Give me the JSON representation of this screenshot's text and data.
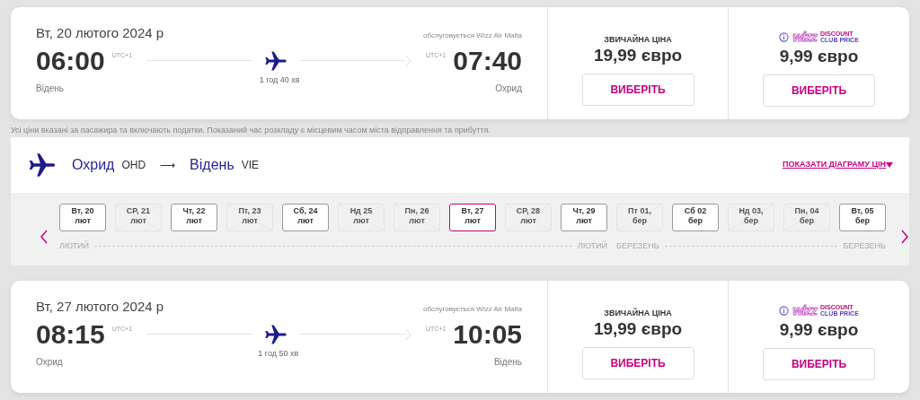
{
  "flights": [
    {
      "date": "Вт, 20 лютого 2024 р",
      "operator": "обслуговується Wizz Air Malta",
      "depart_time": "06:00",
      "depart_tz": "UTC+1",
      "depart_city": "Відень",
      "duration": "1 год 40 хв",
      "arrive_tz": "UTC+1",
      "arrive_time": "07:40",
      "arrive_city": "Охрид",
      "fares": [
        {
          "kind": "regular",
          "label": "ЗВИЧАЙНА ЦІНА",
          "price": "19,99 євро",
          "button": "ВИБЕРІТЬ"
        },
        {
          "kind": "club",
          "logo": "wizz",
          "logo_line1": "DISCOUNT",
          "logo_line2": "CLUB PRICE",
          "price": "9,99 євро",
          "button": "ВИБЕРІТЬ"
        }
      ]
    },
    {
      "date": "Вт, 27 лютого 2024 р",
      "operator": "обслуговується Wizz Air Malta",
      "depart_time": "08:15",
      "depart_tz": "UTC+1",
      "depart_city": "Охрид",
      "duration": "1 год 50 хв",
      "arrive_tz": "UTC+1",
      "arrive_time": "10:05",
      "arrive_city": "Відень",
      "fares": [
        {
          "kind": "regular",
          "label": "ЗВИЧАЙНА ЦІНА",
          "price": "19,99 євро",
          "button": "ВИБЕРІТЬ"
        },
        {
          "kind": "club",
          "logo": "wizz",
          "logo_line1": "DISCOUNT",
          "logo_line2": "CLUB PRICE",
          "price": "9,99 євро",
          "button": "ВИБЕРІТЬ"
        }
      ]
    }
  ],
  "note": "Усі ціни вказані за пасажира та включають податки. Показаний час розкладу є місцевим часом міста відправлення та прибуття.",
  "route": {
    "from_city": "Охрид",
    "from_code": "OHD",
    "arrow": "⟶",
    "to_city": "Відень",
    "to_code": "VIE",
    "chart_link": "ПОКАЗАТИ ДІАГРАМУ ЦІН"
  },
  "months": [
    {
      "labels": [
        "ЛЮТИЙ",
        "ЛЮТИЙ"
      ],
      "days": [
        {
          "day": "Вт, 20",
          "month": "лют",
          "available": true,
          "selected": false
        },
        {
          "day": "СР, 21",
          "month": "лют",
          "available": false,
          "selected": false
        },
        {
          "day": "Чт, 22",
          "month": "лют",
          "available": true,
          "selected": false
        },
        {
          "day": "Пт, 23",
          "month": "лют",
          "available": false,
          "selected": false
        },
        {
          "day": "Сб, 24",
          "month": "лют",
          "available": true,
          "selected": false
        },
        {
          "day": "Нд 25",
          "month": "лют",
          "available": false,
          "selected": false
        },
        {
          "day": "Пн, 26",
          "month": "лют",
          "available": false,
          "selected": false
        },
        {
          "day": "Вт, 27",
          "month": "лют",
          "available": true,
          "selected": true
        },
        {
          "day": "СР, 28",
          "month": "лют",
          "available": false,
          "selected": false
        },
        {
          "day": "Чт, 29",
          "month": "лют",
          "available": true,
          "selected": false
        }
      ]
    },
    {
      "labels": [
        "БЕРЕЗЕНЬ",
        "БЕРЕЗЕНЬ"
      ],
      "days": [
        {
          "day": "Пт 01,",
          "month": "бер",
          "available": false,
          "selected": false
        },
        {
          "day": "Сб 02",
          "month": "бер",
          "available": true,
          "selected": false
        },
        {
          "day": "Нд 03,",
          "month": "бер",
          "available": false,
          "selected": false
        },
        {
          "day": "Пн, 04",
          "month": "бер",
          "available": false,
          "selected": false
        },
        {
          "day": "Вт, 05",
          "month": "бер",
          "available": true,
          "selected": false
        }
      ]
    }
  ]
}
